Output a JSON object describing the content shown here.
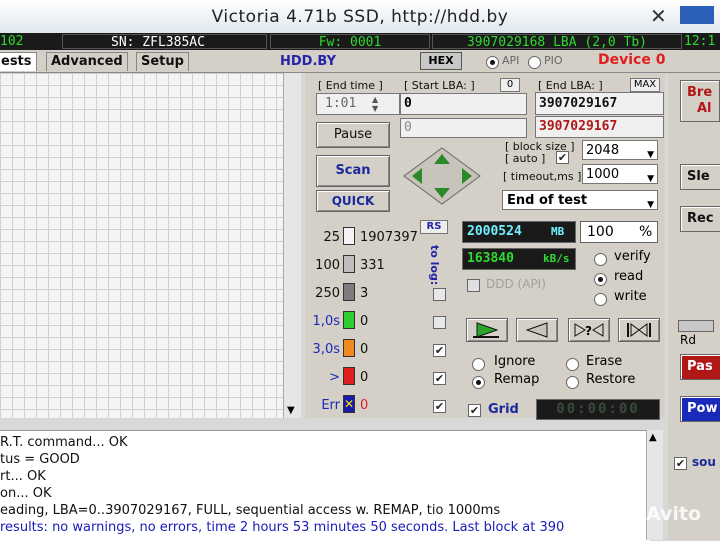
{
  "title": "Victoria 4.71b SSD, http://hdd.by",
  "info_bar": {
    "model_tail": "102",
    "serial": "SN: ZFL385AC",
    "firmware": "Fw: 0001",
    "capacity": "3907029168 LBA (2,0 Tb)",
    "clock": "12:1"
  },
  "tabs": [
    {
      "label": "ests",
      "active": true
    },
    {
      "label": "Advanced",
      "active": false
    },
    {
      "label": "Setup",
      "active": false
    }
  ],
  "brand_link": "HDD.BY",
  "hex_label": "HEX",
  "mode": {
    "api_label": "API",
    "pio_label": "PIO",
    "selected": "API",
    "device_label": "Device 0"
  },
  "end_time": {
    "label": "[ End time ]",
    "value": "1:01"
  },
  "start_lba": {
    "label": "[ Start LBA: ]",
    "value": "0",
    "current": "0",
    "end_label": "[ End LBA: ]",
    "max_label": "MAX"
  },
  "end_lba": {
    "value": "3907029167",
    "current": "3907029167"
  },
  "buttons": {
    "pause": "Pause",
    "scan": "Scan",
    "quick": "QUICK"
  },
  "block_size": {
    "label": "[ block size ]",
    "auto_label": "[ auto ]",
    "auto_checked": true,
    "value": "2048"
  },
  "timeout": {
    "label": "[ timeout,ms ]",
    "value": "1000"
  },
  "end_action": "End of test",
  "rs_label": "RS",
  "to_log_label": "to log:",
  "timing_counts": [
    {
      "label": "25",
      "count": "1907397",
      "color": "#f4f4f4",
      "log": false
    },
    {
      "label": "100",
      "count": "331",
      "color": "#bdbdbd",
      "log": false
    },
    {
      "label": "250",
      "count": "3",
      "color": "#7d7d7d",
      "log": false
    },
    {
      "label": "1,0s",
      "count": "0",
      "color": "#2ecc2e",
      "log": false
    },
    {
      "label": "3,0s",
      "count": "0",
      "color": "#f08a1e",
      "log": true
    },
    {
      "label": ">",
      "count": "0",
      "color": "#e01e1e",
      "log": true
    },
    {
      "label": "Err",
      "count": "0",
      "color": "#1e3ed8",
      "log": true
    }
  ],
  "progress": {
    "mb": "2000524",
    "mb_unit": "MB",
    "percent": "100",
    "percent_unit": "%",
    "speed": "163840",
    "speed_unit": "kB/s"
  },
  "ddd_label": "DDD (API)",
  "test_mode": {
    "options": [
      "verify",
      "read",
      "write"
    ],
    "selected": "read"
  },
  "action_mode": {
    "options": [
      "Ignore",
      "Erase",
      "Remap",
      "Restore"
    ],
    "selected": "Remap"
  },
  "grid_label": "Grid",
  "grid_checked": true,
  "timer": "00:00:00",
  "log_lines": [
    "R.T. command... OK",
    "tus = GOOD",
    "rt... OK",
    "on... OK",
    "eading, LBA=0..3907029167, FULL, sequential access w. REMAP, tio 1000ms",
    "results: no warnings, no errors, time 2 hours 53 minutes 50 seconds. Last block at 390"
  ],
  "right_buttons": [
    "Bre",
    "Al",
    "Sle",
    "Rec",
    "Rd",
    "Pas",
    "Pow"
  ],
  "sound_label": "sou",
  "watermark": "Avito"
}
